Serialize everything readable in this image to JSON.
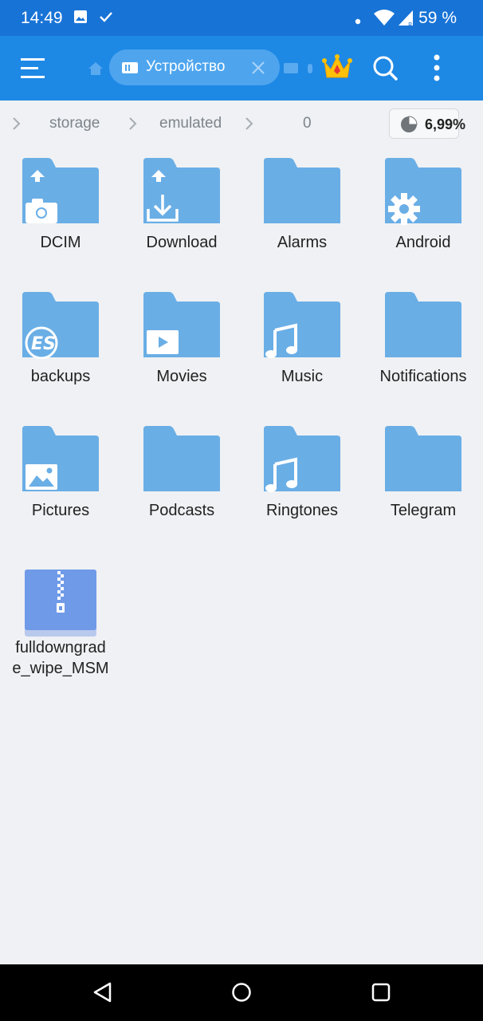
{
  "status_bar": {
    "time": "14:49",
    "battery": "59 %"
  },
  "app_bar": {
    "tab_label": "Устройство"
  },
  "breadcrumb": {
    "items": [
      "storage",
      "emulated",
      "0"
    ],
    "storage_usage": "6,99%"
  },
  "files": [
    {
      "name": "DCIM",
      "kind": "folder",
      "badge": "camera-upload"
    },
    {
      "name": "Download",
      "kind": "folder",
      "badge": "download-upload"
    },
    {
      "name": "Alarms",
      "kind": "folder",
      "badge": "none"
    },
    {
      "name": "Android",
      "kind": "folder",
      "badge": "gear"
    },
    {
      "name": "backups",
      "kind": "folder",
      "badge": "es-logo"
    },
    {
      "name": "Movies",
      "kind": "folder",
      "badge": "play"
    },
    {
      "name": "Music",
      "kind": "folder",
      "badge": "music-note"
    },
    {
      "name": "Notifications",
      "kind": "folder",
      "badge": "none"
    },
    {
      "name": "Pictures",
      "kind": "folder",
      "badge": "picture"
    },
    {
      "name": "Podcasts",
      "kind": "folder",
      "badge": "none"
    },
    {
      "name": "Ringtones",
      "kind": "folder",
      "badge": "music-note"
    },
    {
      "name": "Telegram",
      "kind": "folder",
      "badge": "none"
    },
    {
      "name": "fulldowngrade_wipe_MSM",
      "kind": "zip",
      "label_lines": [
        "fulldowngrad",
        "e_wipe_MSM"
      ]
    }
  ],
  "colors": {
    "status_bar": "#1873d6",
    "app_bar": "#1e88e5",
    "folder": "#6aaee6",
    "folder_tab": "#5ba3e2",
    "zip": "#6f9ae8",
    "background": "#eff1f4"
  }
}
